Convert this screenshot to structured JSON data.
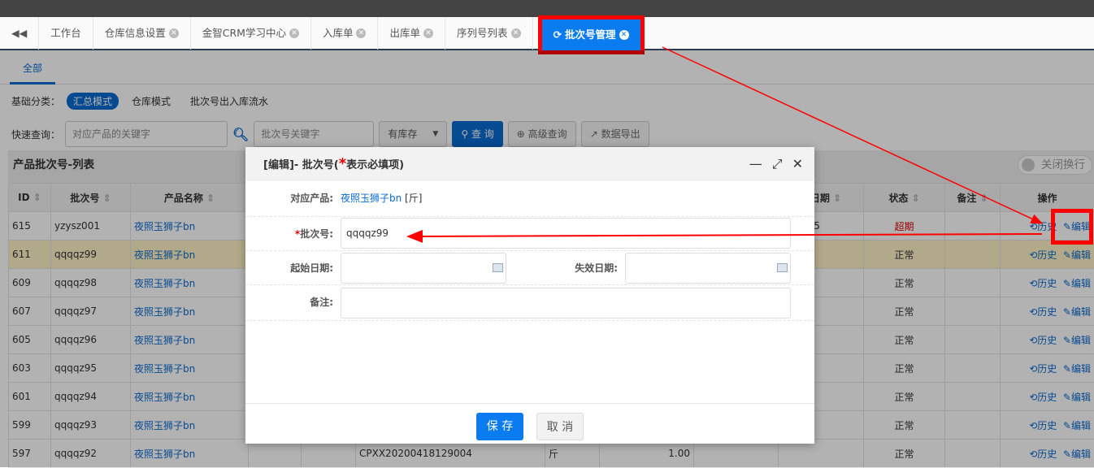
{
  "tabs": [
    "工作台",
    "仓库信息设置",
    "金智CRM学习中心",
    "入库单",
    "出库单",
    "序列号列表",
    "批次号管理"
  ],
  "subtab": "全部",
  "category": {
    "label": "基础分类：",
    "items": [
      "汇总模式",
      "仓库模式",
      "批次号出入库流水"
    ]
  },
  "search": {
    "label": "快速查询：",
    "product_placeholder": "对应产品的关键字",
    "batch_placeholder": "批次号关键字",
    "stock_select": "有库存",
    "query": "查 询",
    "advanced": "高级查询",
    "export": "数据导出"
  },
  "panel": {
    "title": "产品批次号-列表",
    "toggle": "关闭换行"
  },
  "table": {
    "headers": [
      "ID",
      "批次号",
      "产品名称",
      "",
      "",
      "",
      "",
      "",
      "",
      "效日期",
      "状态",
      "备注",
      "操作"
    ],
    "rows": [
      {
        "id": "615",
        "batch": "yzysz001",
        "product": "夜照玉狮子bn",
        "code": "",
        "unit": "",
        "qty": "",
        "date": "0-06-05",
        "status": "超期"
      },
      {
        "id": "611",
        "batch": "qqqqz99",
        "product": "夜照玉狮子bn",
        "code": "",
        "unit": "",
        "qty": "",
        "date": "",
        "status": "正常"
      },
      {
        "id": "609",
        "batch": "qqqqz98",
        "product": "夜照玉狮子bn",
        "code": "",
        "unit": "",
        "qty": "",
        "date": "",
        "status": "正常"
      },
      {
        "id": "607",
        "batch": "qqqqz97",
        "product": "夜照玉狮子bn",
        "code": "",
        "unit": "",
        "qty": "",
        "date": "",
        "status": "正常"
      },
      {
        "id": "605",
        "batch": "qqqqz96",
        "product": "夜照玉狮子bn",
        "code": "",
        "unit": "",
        "qty": "",
        "date": "",
        "status": "正常"
      },
      {
        "id": "603",
        "batch": "qqqqz95",
        "product": "夜照玉狮子bn",
        "code": "",
        "unit": "",
        "qty": "",
        "date": "",
        "status": "正常"
      },
      {
        "id": "601",
        "batch": "qqqqz94",
        "product": "夜照玉狮子bn",
        "code": "",
        "unit": "",
        "qty": "",
        "date": "",
        "status": "正常"
      },
      {
        "id": "599",
        "batch": "qqqqz93",
        "product": "夜照玉狮子bn",
        "code": "",
        "unit": "",
        "qty": "",
        "date": "",
        "status": "正常"
      },
      {
        "id": "597",
        "batch": "qqqqz92",
        "product": "夜照玉狮子bn",
        "code": "CPXX20200418129004",
        "unit": "斤",
        "qty": "1.00",
        "date": "",
        "status": "正常"
      }
    ],
    "history": "历史",
    "edit": "编辑"
  },
  "modal": {
    "title_prefix": "[编辑]- 批次号(",
    "star": "*",
    "title_suffix": "表示必填项)",
    "product_label": "对应产品:",
    "product_value": "夜照玉狮子bn",
    "product_unit": " [斤]",
    "batch_label": "批次号:",
    "batch_value": "qqqqz99",
    "start_label": "起始日期:",
    "end_label": "失效日期:",
    "note_label": "备注:",
    "save": "保 存",
    "cancel": "取 消"
  }
}
